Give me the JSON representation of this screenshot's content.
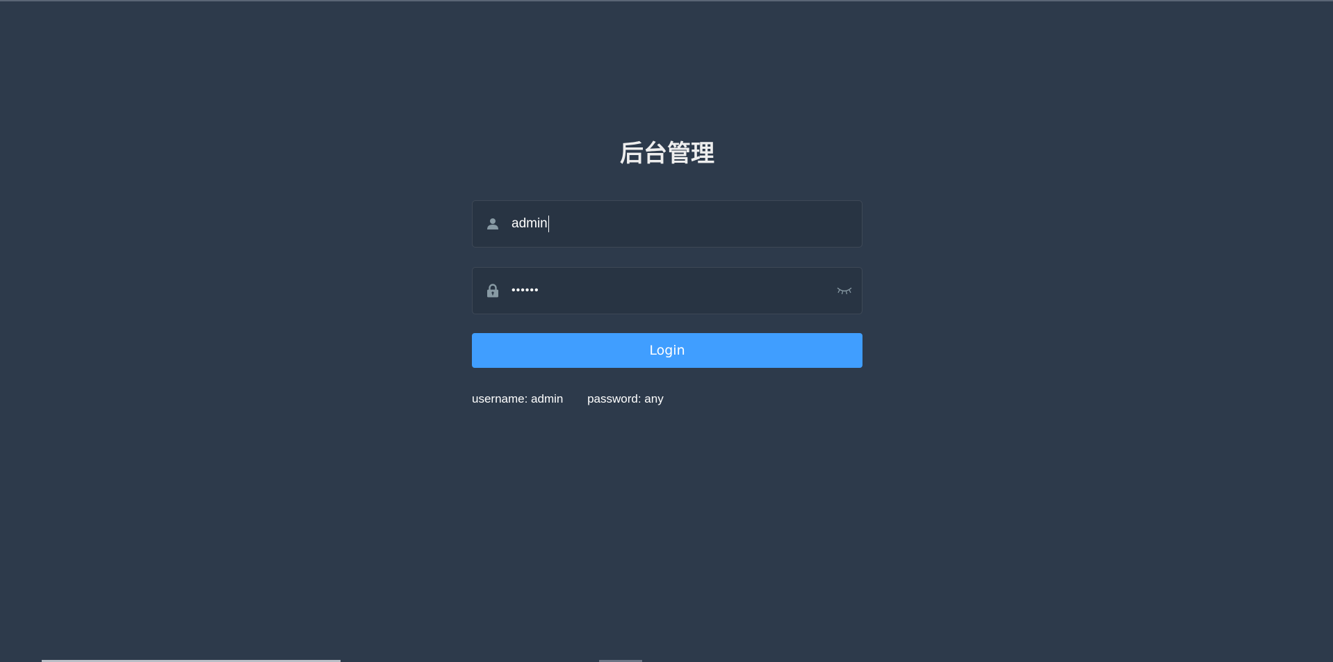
{
  "login": {
    "title": "后台管理",
    "username": {
      "icon": "user-icon",
      "value": "admin"
    },
    "password": {
      "icon": "lock-icon",
      "value": "••••••",
      "toggle_icon": "eye-closed-icon"
    },
    "button_label": "Login",
    "tips": {
      "username": "username: admin",
      "password": "password: any"
    }
  },
  "colors": {
    "background": "#2d3a4b",
    "button": "#409eff",
    "icon": "#889aa4",
    "text": "#ffffff",
    "title": "#eeeeee"
  }
}
